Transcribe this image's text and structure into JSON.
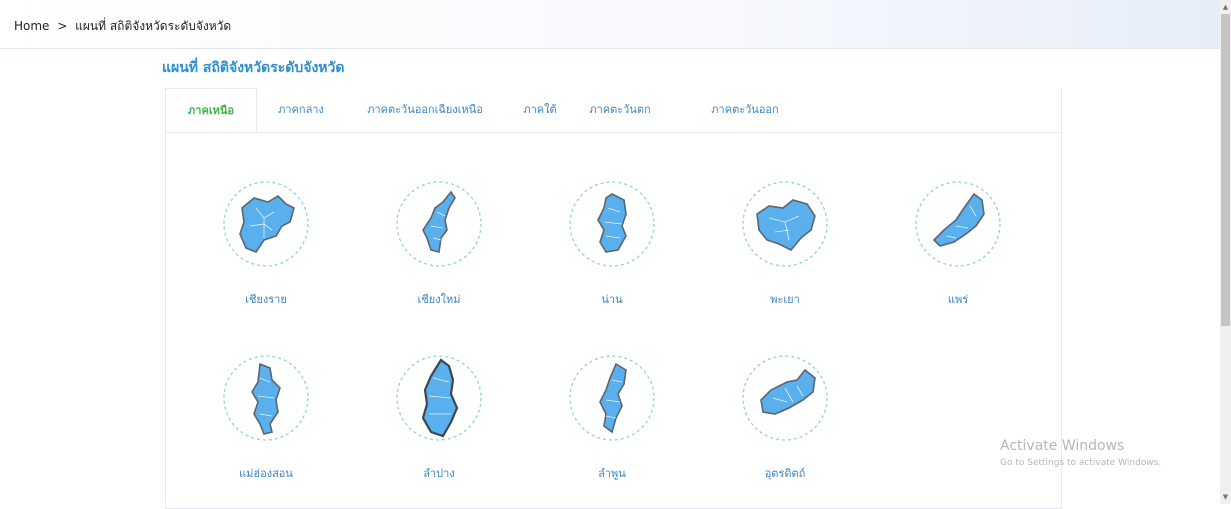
{
  "breadcrumb": {
    "home": "Home",
    "separator": ">",
    "current": "แผนที่ สถิติจังหวัดระดับจังหวัด"
  },
  "page_title": "แผนที่ สถิติจังหวัดระดับจังหวัด",
  "tabs": [
    {
      "label": "ภาคเหนือ",
      "active": true
    },
    {
      "label": "ภาคกลาง",
      "active": false
    },
    {
      "label": "ภาคตะวันออกเฉียงเหนือ",
      "active": false
    },
    {
      "label": "ภาคใต้",
      "active": false
    },
    {
      "label": "ภาคตะวันตก",
      "active": false
    },
    {
      "label": "ภาคตะวันออก",
      "active": false
    }
  ],
  "provinces": [
    {
      "name": "เชียงราย"
    },
    {
      "name": "เชียงใหม่"
    },
    {
      "name": "น่าน"
    },
    {
      "name": "พะเยา"
    },
    {
      "name": "แพร่"
    },
    {
      "name": "แม่ฮ่องสอน"
    },
    {
      "name": "ลำปาง"
    },
    {
      "name": "ลำพูน"
    },
    {
      "name": "อุตรดิตถ์"
    }
  ],
  "watermark": {
    "title": "Activate Windows",
    "subtitle": "Go to Settings to activate Windows."
  },
  "colors": {
    "map_fill": "#5ab0ec",
    "map_stroke": "#5a6572",
    "circle": "#8fd3d1",
    "tab_active": "#3db54a",
    "link": "#3b86c4"
  }
}
